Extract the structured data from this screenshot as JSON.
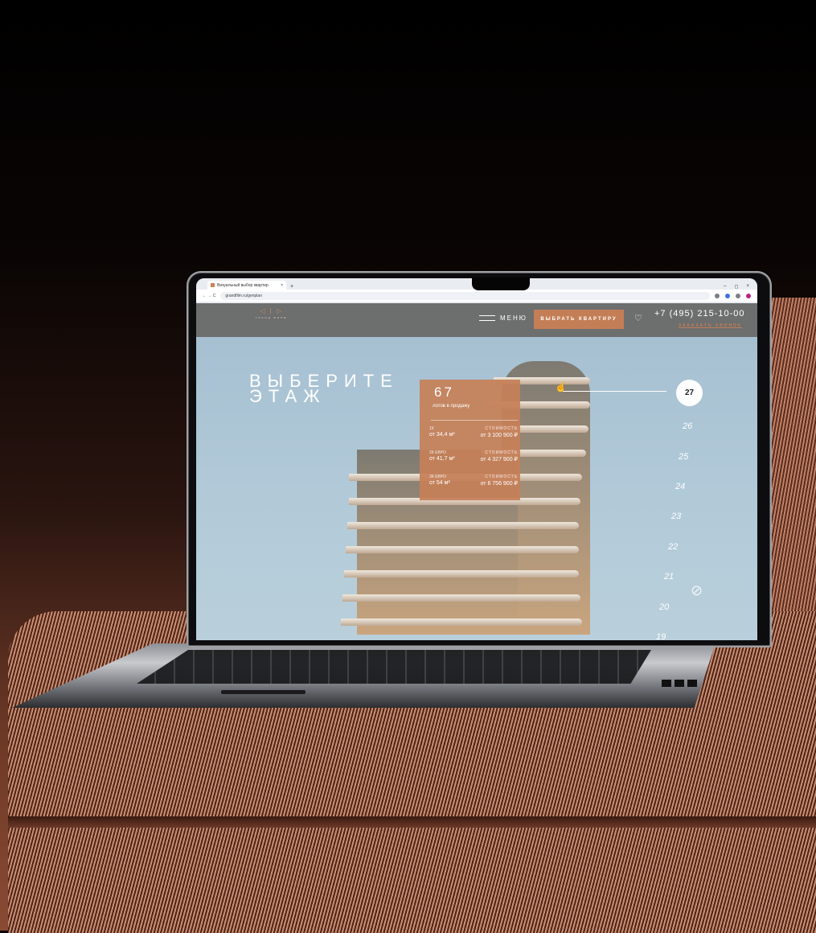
{
  "browser": {
    "tab_title": "Визуальный выбор квартир",
    "tab_close": "×",
    "new_tab": "+",
    "nav": "← → C",
    "url": "grandfilm.ru/genplan",
    "window_controls": [
      "–",
      "◻",
      "×"
    ]
  },
  "header": {
    "logo_mark": "◁ | ▷",
    "logo_text": "ГРАНД ФИЛМ",
    "menu_label": "МЕНЮ",
    "cta_label": "ВЫБРАТЬ КВАРТИРУ",
    "favorite_icon": "heart-icon",
    "phone": "+7 (495) 215-10-00",
    "callback_label": "ЗАКАЗАТЬ ЗВОНОК"
  },
  "hero": {
    "title_line1": "ВЫБЕРИТЕ",
    "title_line2": "ЭТАЖ"
  },
  "card": {
    "count": "67",
    "count_label": "лотов в продажу",
    "rows": [
      {
        "type": "1К",
        "area": "от 34,4 м²",
        "price_label": "СТОИМОСТЬ",
        "price": "от 3 100 900 ₽"
      },
      {
        "type": "2К ЕВРО",
        "area": "от 41,7 м²",
        "price_label": "СТОИМОСТЬ",
        "price": "от 4 327 900 ₽"
      },
      {
        "type": "3К ЕВРО",
        "area": "от 54 м²",
        "price_label": "СТОИМОСТЬ",
        "price": "от 6 756 900 ₽"
      }
    ]
  },
  "floors": {
    "active": "27",
    "list": [
      "26",
      "25",
      "24",
      "23",
      "22",
      "21",
      "20",
      "19"
    ]
  },
  "colors": {
    "accent": "#c47e56",
    "header_bg": "#6d6e6e",
    "sky": "#a9c3d4"
  }
}
